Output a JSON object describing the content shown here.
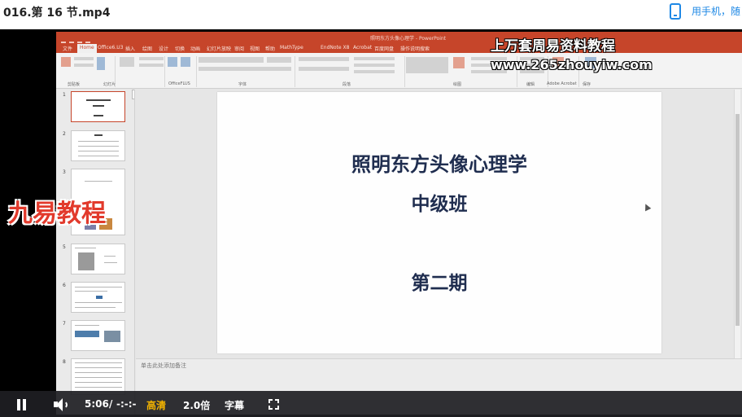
{
  "video": {
    "title": "016.第 16 节.mp4",
    "phone_link": "用手机，随"
  },
  "powerpoint": {
    "doc_title": "照明东方头像心理学 - PowerPoint",
    "tabs": [
      "文件",
      "Home",
      "Office6.U3",
      "插入",
      "绘图",
      "设计",
      "切换",
      "动画",
      "幻灯片放映",
      "审阅",
      "视图",
      "帮助",
      "MathType",
      "EndNote X8",
      "Acrobat",
      "百度网盘",
      "操作说明搜索"
    ],
    "active_tab": "Home",
    "ribbon_groups": [
      "剪贴板",
      "幻灯片",
      "OfficeFLUS",
      "字体",
      "段落",
      "绘图",
      "编辑",
      "Adobe Acrobat",
      "保存"
    ],
    "slide_numbers": [
      "1",
      "2",
      "3",
      "5",
      "6",
      "7",
      "8"
    ],
    "notes_placeholder": "单击此处添加备注",
    "slide": {
      "line1": "照明东方头像心理学",
      "line2": "中级班",
      "line3": "第二期"
    }
  },
  "watermarks": {
    "top": "上万套周易资料教程",
    "url": "www.265zhouyiw.com",
    "left": "九易教程"
  },
  "controls": {
    "current_time": "5:06",
    "separator": "/",
    "duration": "-:-:-",
    "quality": "高清",
    "speed": "2.0倍",
    "subtitles": "字幕"
  },
  "icons": {
    "phone": "phone-icon",
    "pause": "pause-icon",
    "volume": "volume-icon",
    "fullscreen": "fullscreen-icon"
  },
  "colors": {
    "ppt_accent": "#c6452a",
    "slide_text": "#1f2d4f",
    "quality_accent": "#f4b400",
    "link": "#1e88e5"
  }
}
